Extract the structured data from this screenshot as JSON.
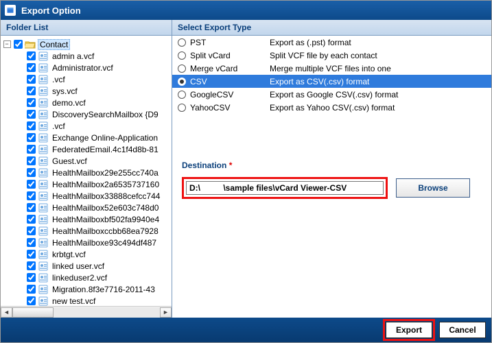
{
  "window": {
    "title": "Export Option"
  },
  "left": {
    "header": "Folder List",
    "root": {
      "label": "Contact",
      "expanded": true
    },
    "items": [
      {
        "label": "admin a.vcf"
      },
      {
        "label": "Administrator.vcf"
      },
      {
        "label": "              .vcf"
      },
      {
        "label": "         sys.vcf"
      },
      {
        "label": "demo.vcf"
      },
      {
        "label": "DiscoverySearchMailbox {D9"
      },
      {
        "label": "              .vcf"
      },
      {
        "label": "Exchange Online-Application"
      },
      {
        "label": "FederatedEmail.4c1f4d8b-81"
      },
      {
        "label": "Guest.vcf"
      },
      {
        "label": "HealthMailbox29e255cc740a"
      },
      {
        "label": "HealthMailbox2a6535737160"
      },
      {
        "label": "HealthMailbox33888cefcc744"
      },
      {
        "label": "HealthMailbox52e603c748d0"
      },
      {
        "label": "HealthMailboxbf502fa9940e4"
      },
      {
        "label": "HealthMailboxccbb68ea7928"
      },
      {
        "label": "HealthMailboxe93c494df487"
      },
      {
        "label": "krbtgt.vcf"
      },
      {
        "label": "linked user.vcf"
      },
      {
        "label": "linkeduser2.vcf"
      },
      {
        "label": "Migration.8f3e7716-2011-43"
      },
      {
        "label": "new test.vcf"
      }
    ]
  },
  "right": {
    "header": "Select Export Type",
    "options": [
      {
        "name": "PST",
        "desc": "Export as (.pst) format"
      },
      {
        "name": "Split vCard",
        "desc": "Split VCF file by each contact"
      },
      {
        "name": "Merge vCard",
        "desc": "Merge multiple VCF files into one"
      },
      {
        "name": "CSV",
        "desc": "Export as CSV(.csv) format",
        "selected": true
      },
      {
        "name": "GoogleCSV",
        "desc": "Export as Google CSV(.csv) format"
      },
      {
        "name": "YahooCSV",
        "desc": "Export as Yahoo CSV(.csv) format"
      }
    ],
    "destination_label": "Destination",
    "destination_value": "D:\\          \\sample files\\vCard Viewer-CSV",
    "browse": "Browse"
  },
  "footer": {
    "export": "Export",
    "cancel": "Cancel"
  }
}
